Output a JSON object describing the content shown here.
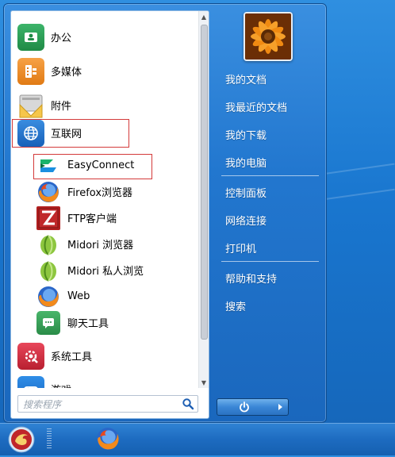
{
  "start_menu": {
    "programs": [
      {
        "label": "办公",
        "icon": "office-icon"
      },
      {
        "label": "多媒体",
        "icon": "multimedia-icon"
      },
      {
        "label": "附件",
        "icon": "accessories-icon"
      },
      {
        "label": "互联网",
        "icon": "internet-icon"
      },
      {
        "label": "EasyConnect",
        "icon": "easyconnect-icon"
      },
      {
        "label": "Firefox浏览器",
        "icon": "firefox-icon"
      },
      {
        "label": "FTP客户端",
        "icon": "filezilla-icon"
      },
      {
        "label": "Midori 浏览器",
        "icon": "midori-icon"
      },
      {
        "label": "Midori 私人浏览",
        "icon": "midori-icon"
      },
      {
        "label": "Web",
        "icon": "web-icon"
      },
      {
        "label": "聊天工具",
        "icon": "chat-icon"
      },
      {
        "label": "系统工具",
        "icon": "system-tools-icon"
      },
      {
        "label": "游戏",
        "icon": "games-icon"
      }
    ],
    "search": {
      "placeholder": "搜索程序"
    },
    "places": [
      "我的文档",
      "我最近的文档",
      "我的下载",
      "我的电脑",
      "控制面板",
      "网络连接",
      "打印机",
      "帮助和支持",
      "搜索"
    ],
    "user_avatar": "flower-avatar",
    "power": {
      "icon": "power-icon",
      "more_icon": "arrow-right-icon"
    }
  },
  "taskbar": {
    "start_icon": "start-orb-icon",
    "items": [
      {
        "icon": "firefox-icon"
      }
    ]
  },
  "colors": {
    "highlight_border": "#d43a3a",
    "desktop_blue": "#1976cf",
    "link_text": "#ffffff"
  }
}
